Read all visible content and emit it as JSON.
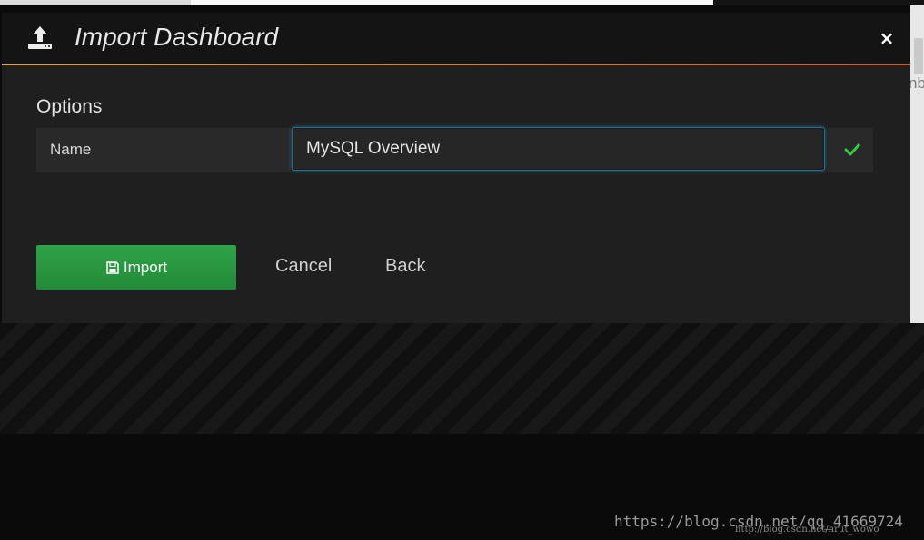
{
  "modal": {
    "title": "Import Dashboard",
    "header_icon": "upload-icon",
    "close_icon": "close-icon",
    "close_label": "×"
  },
  "options": {
    "section_title": "Options",
    "name_label": "Name",
    "name_value": "MySQL Overview",
    "valid_icon": "check-icon"
  },
  "actions": {
    "import_label": "Import",
    "import_icon": "save-icon",
    "cancel_label": "Cancel",
    "back_label": "Back"
  },
  "background": {
    "fragment_text": "nb"
  },
  "watermark": {
    "text": "https://blog.csdn.net/qq_41669724",
    "small_text": "http://blog.csdn.net/hrut_wowo"
  },
  "colors": {
    "accent_gradient_start": "#f0a020",
    "accent_gradient_end": "#e8520f",
    "primary_button": "#2ea347",
    "check": "#2ecc40",
    "input_focus": "#1d6f96"
  }
}
